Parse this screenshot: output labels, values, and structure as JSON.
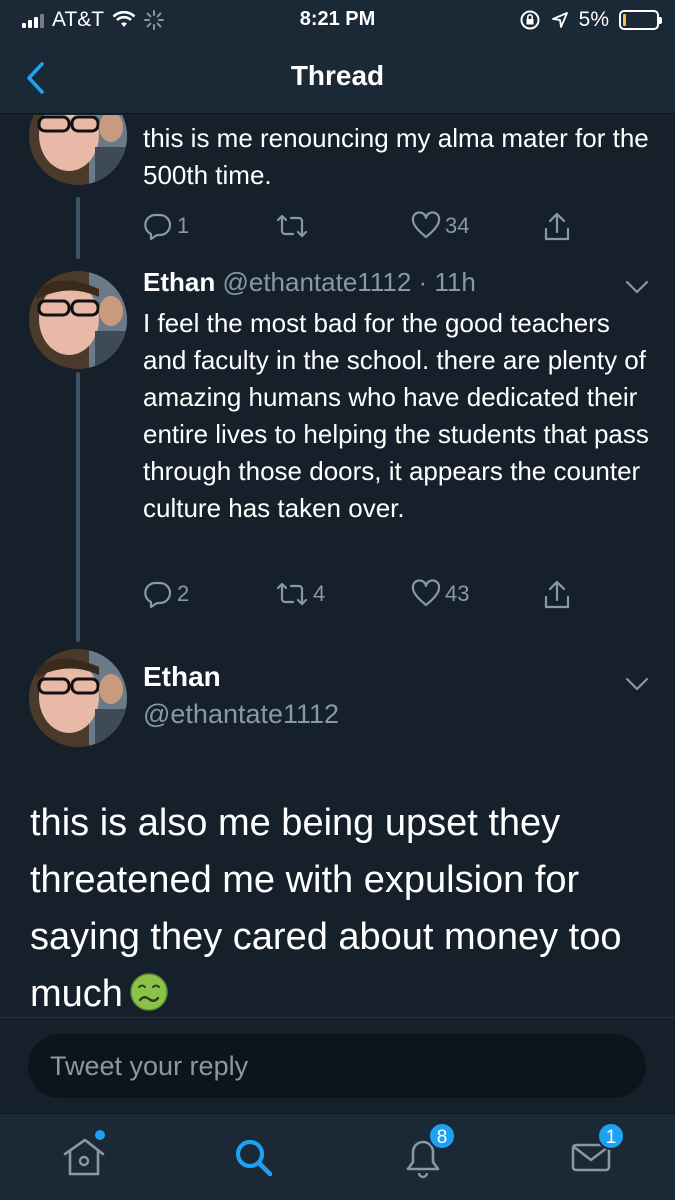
{
  "status_bar": {
    "carrier": "AT&T",
    "time": "8:21 PM",
    "battery_percent": "5%",
    "battery_level": 0.05
  },
  "nav": {
    "title": "Thread"
  },
  "tweets": [
    {
      "text": "this is me renouncing my alma mater for the 500th time.",
      "reply_count": "1",
      "retweet_count": "",
      "like_count": "34"
    },
    {
      "name": "Ethan",
      "handle": "@ethantate1112",
      "time": "· 11h",
      "text": "I feel the most bad for the good teachers and faculty in the school. there are plenty of amazing humans who have dedicated their entire lives to helping the students that pass through those doors, it appears the counter culture has taken over.",
      "reply_count": "2",
      "retweet_count": "4",
      "like_count": "43"
    }
  ],
  "main_tweet": {
    "name": "Ethan",
    "handle": "@ethantate1112",
    "text": "this is also me being upset they threatened me with expulsion for saying they cared about money too much"
  },
  "reply": {
    "placeholder": "Tweet your reply"
  },
  "tab_bar": {
    "notifications_badge": "8",
    "messages_badge": "1"
  },
  "colors": {
    "background": "#15202b",
    "accent": "#1da1f2",
    "muted": "#8899a6"
  }
}
